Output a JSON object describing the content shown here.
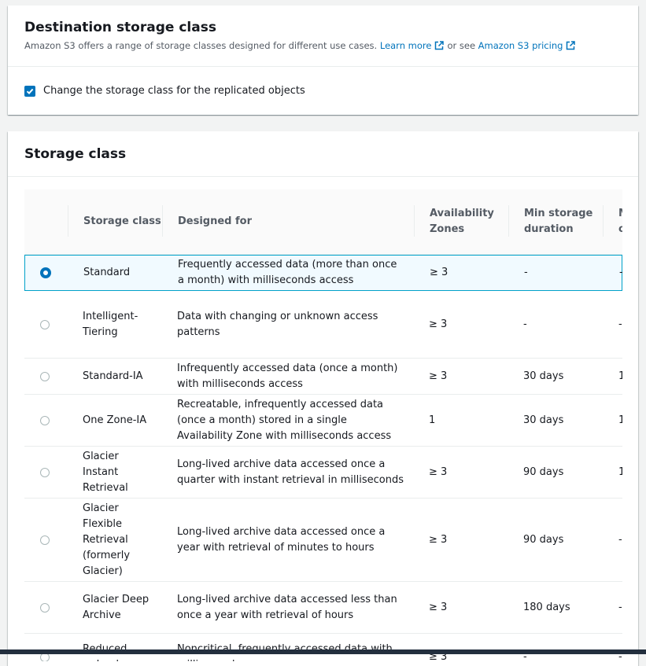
{
  "destination": {
    "title": "Destination storage class",
    "description": "Amazon S3 offers a range of storage classes designed for different use cases.",
    "learn_more": "Learn more",
    "or_see": "or see",
    "pricing": "Amazon S3 pricing",
    "checkbox_label": "Change the storage class for the replicated objects",
    "checkbox_checked": true
  },
  "storage": {
    "title": "Storage class",
    "columns": [
      "Storage class",
      "Designed for",
      "Availability Zones",
      "Min storage duration",
      "Min billable object size"
    ],
    "selected": "Standard",
    "rows": [
      {
        "name": "Standard",
        "designed_for": "Frequently accessed data (more than once a month) with milliseconds access",
        "az": "≥ 3",
        "min_duration": "-",
        "min_size": "-"
      },
      {
        "name": "Intelligent-Tiering",
        "designed_for": "Data with changing or unknown access patterns",
        "az": "≥ 3",
        "min_duration": "-",
        "min_size": "-"
      },
      {
        "name": "Standard-IA",
        "designed_for": "Infrequently accessed data (once a month) with milliseconds access",
        "az": "≥ 3",
        "min_duration": "30 days",
        "min_size": "1"
      },
      {
        "name": "One Zone-IA",
        "designed_for": "Recreatable, infrequently accessed data (once a month) stored in a single Availability Zone with milliseconds access",
        "az": "1",
        "min_duration": "30 days",
        "min_size": "1"
      },
      {
        "name": "Glacier Instant Retrieval",
        "designed_for": "Long-lived archive data accessed once a quarter with instant retrieval in milliseconds",
        "az": "≥ 3",
        "min_duration": "90 days",
        "min_size": "1"
      },
      {
        "name": "Glacier Flexible Retrieval (formerly Glacier)",
        "designed_for": "Long-lived archive data accessed once a year with retrieval of minutes to hours",
        "az": "≥ 3",
        "min_duration": "90 days",
        "min_size": "-"
      },
      {
        "name": "Glacier Deep Archive",
        "designed_for": "Long-lived archive data accessed less than once a year with retrieval of hours",
        "az": "≥ 3",
        "min_duration": "180 days",
        "min_size": "-"
      },
      {
        "name": "Reduced redundancy",
        "designed_for": "Noncritical, frequently accessed data with milliseconds access",
        "az": "≥ 3",
        "min_duration": "-",
        "min_size": "-"
      }
    ]
  },
  "colors": {
    "accent": "#0073bb",
    "selected_border": "#00a1c9",
    "selected_bg": "#f1faff"
  }
}
